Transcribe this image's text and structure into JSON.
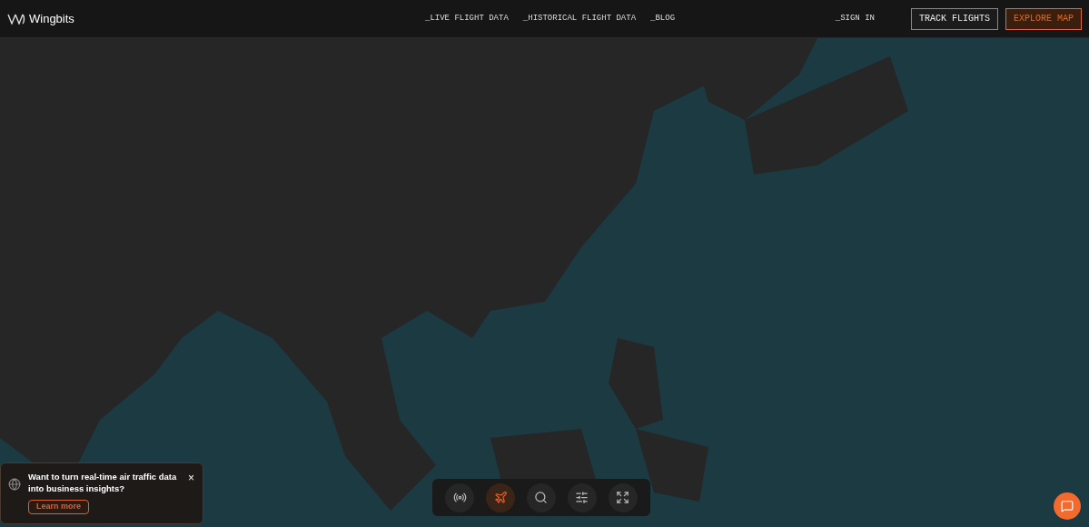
{
  "brand": {
    "name": "Wingbits"
  },
  "nav": {
    "links": [
      "_LIVE FLIGHT DATA",
      "_HISTORICAL FLIGHT DATA",
      "_BLOG"
    ],
    "sign_in": "_SIGN IN",
    "buttons": [
      {
        "label": "TRACK FLIGHTS",
        "kind": "outline"
      },
      {
        "label": "EXPLORE MAP",
        "kind": "accent"
      }
    ]
  },
  "promo": {
    "text": "Want to turn real-time air traffic data into business insights?",
    "button": "Learn more",
    "close": "×"
  },
  "toolbar": {
    "tools": [
      {
        "kind": "coverage",
        "selected": false
      },
      {
        "kind": "flights",
        "selected": true
      },
      {
        "kind": "search",
        "selected": false
      },
      {
        "kind": "filters",
        "selected": false
      },
      {
        "kind": "fullscreen",
        "selected": false
      }
    ]
  }
}
